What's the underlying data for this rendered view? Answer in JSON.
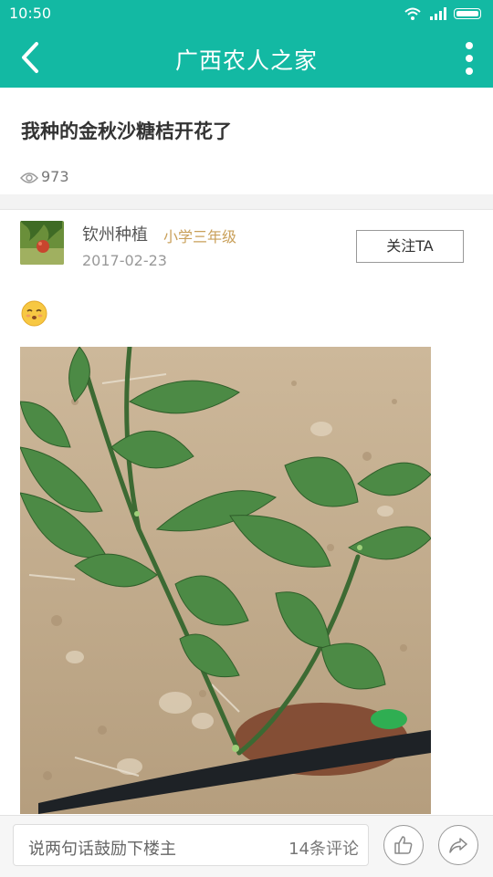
{
  "status_bar": {
    "time": "10:50"
  },
  "app_bar": {
    "title": "广西农人之家"
  },
  "post": {
    "title": "我种的金秋沙糖桔开花了",
    "views": "973"
  },
  "author": {
    "name": "钦州种植",
    "level": "小学三年级",
    "date": "2017-02-23",
    "follow_label": "关注TA"
  },
  "bottom_bar": {
    "comment_placeholder": "说两句话鼓励下楼主",
    "comment_count": "14条评论"
  },
  "colors": {
    "accent": "#13b9a3",
    "level_gold": "#c9a05a"
  }
}
